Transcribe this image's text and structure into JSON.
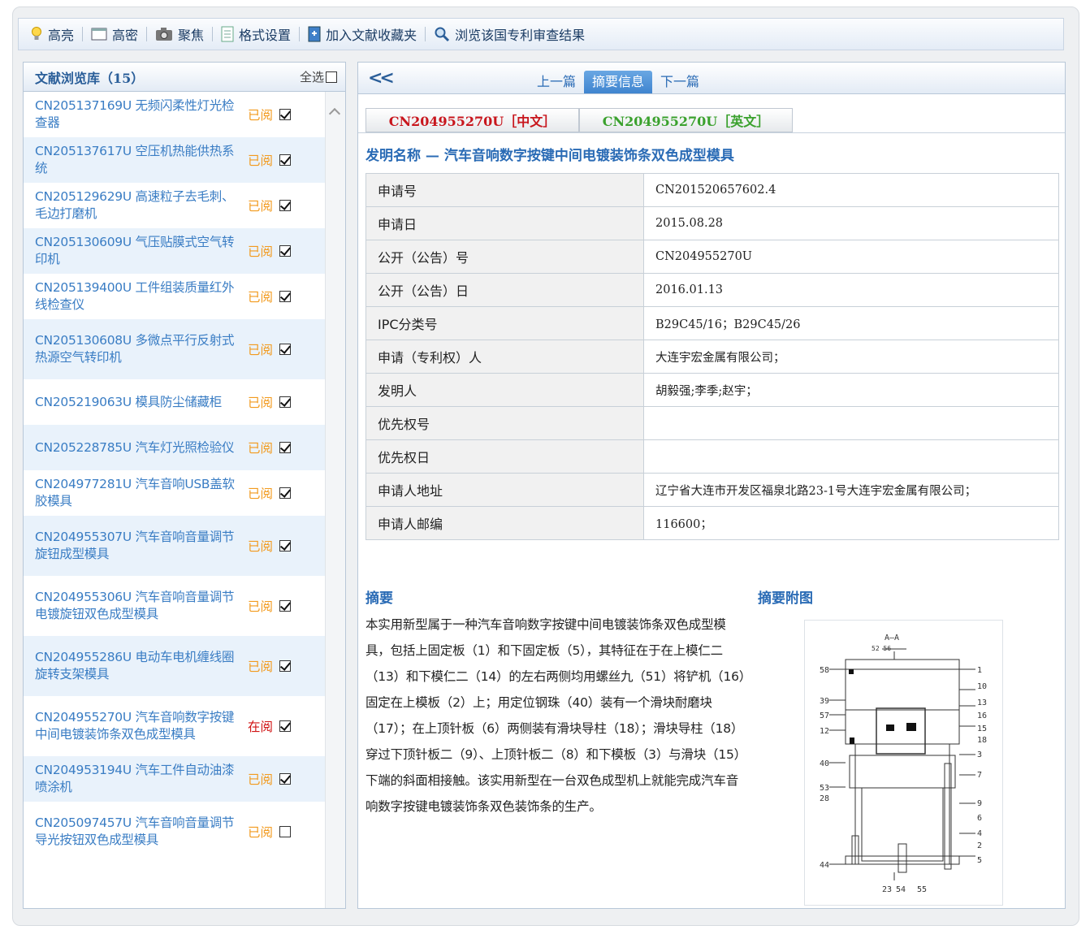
{
  "toolbar": {
    "items": [
      {
        "label": "高亮",
        "icon": "bulb-icon"
      },
      {
        "label": "高密",
        "icon": "window-icon"
      },
      {
        "label": "聚焦",
        "icon": "camera-icon"
      },
      {
        "label": "格式设置",
        "icon": "document-icon"
      },
      {
        "label": "加入文献收藏夹",
        "icon": "bookmark-add-icon"
      },
      {
        "label": "浏览该国专利审查结果",
        "icon": "magnifier-icon"
      }
    ]
  },
  "library": {
    "title": "文献浏览库（15）",
    "select_all": "全选",
    "items": [
      {
        "title": "CN205137169U 无频闪柔性灯光检查器",
        "status": "已阅",
        "checked": true
      },
      {
        "title": "CN205137617U 空压机热能供热系统",
        "status": "已阅",
        "checked": true
      },
      {
        "title": "CN205129629U 高速粒子去毛刺、毛边打磨机",
        "status": "已阅",
        "checked": true
      },
      {
        "title": "CN205130609U 气压贴膜式空气转印机",
        "status": "已阅",
        "checked": true
      },
      {
        "title": "CN205139400U 工件组装质量红外线检查仪",
        "status": "已阅",
        "checked": true
      },
      {
        "title": "CN205130608U 多微点平行反射式热源空气转印机",
        "status": "已阅",
        "checked": true
      },
      {
        "title": "CN205219063U 模具防尘储藏柜",
        "status": "已阅",
        "checked": true
      },
      {
        "title": "CN205228785U 汽车灯光照检验仪",
        "status": "已阅",
        "checked": true
      },
      {
        "title": "CN204977281U 汽车音响USB盖软胶模具",
        "status": "已阅",
        "checked": true
      },
      {
        "title": "CN204955307U 汽车音响音量调节旋钮成型模具",
        "status": "已阅",
        "checked": true
      },
      {
        "title": "CN204955306U 汽车音响音量调节电镀旋钮双色成型模具",
        "status": "已阅",
        "checked": true
      },
      {
        "title": "CN204955286U 电动车电机缠线圈旋转支架模具",
        "status": "已阅",
        "checked": true
      },
      {
        "title": "CN204955270U 汽车音响数字按键中间电镀装饰条双色成型模具",
        "status": "在阅",
        "checked": true,
        "current": true
      },
      {
        "title": "CN204953194U 汽车工件自动油漆喷涂机",
        "status": "已阅",
        "checked": true
      },
      {
        "title": "CN205097457U 汽车音响音量调节导光按钮双色成型模具",
        "status": "已阅",
        "checked": false
      }
    ]
  },
  "detail": {
    "back": "<<",
    "prev": "上一篇",
    "current_tab": "摘要信息",
    "next": "下一篇",
    "lang_cn": "CN204955270U［中文］",
    "lang_en": "CN204955270U［英文］",
    "invention_name": "发明名称 — 汽车音响数字按键中间电镀装饰条双色成型模具",
    "fields": [
      {
        "key": "申请号",
        "value": "CN201520657602.4"
      },
      {
        "key": "申请日",
        "value": "2015.08.28"
      },
      {
        "key": "公开（公告）号",
        "value": "CN204955270U"
      },
      {
        "key": "公开（公告）日",
        "value": "2016.01.13"
      },
      {
        "key": "IPC分类号",
        "value": "B29C45/16；B29C45/26"
      },
      {
        "key": "申请（专利权）人",
        "value": "大连宇宏金属有限公司；"
      },
      {
        "key": "发明人",
        "value": "胡毅强;李季;赵宇；"
      },
      {
        "key": "优先权号",
        "value": ""
      },
      {
        "key": "优先权日",
        "value": ""
      },
      {
        "key": "申请人地址",
        "value": "辽宁省大连市开发区福泉北路23-1号大连宇宏金属有限公司；"
      },
      {
        "key": "申请人邮编",
        "value": "116600；"
      }
    ],
    "abstract_heading": "摘要",
    "figure_heading": "摘要附图",
    "abstract": "本实用新型属于一种汽车音响数字按键中间电镀装饰条双色成型模具，包括上固定板（1）和下固定板（5），其特征在于在上模仁二（13）和下模仁二（14）的左右两侧均用螺丝九（51）将铲机（16）固定在上模板（2）上；用定位钢珠（40）装有一个滑块耐磨块（17）；在上顶针板（6）两侧装有滑块导柱（18）；滑块导柱（18）穿过下顶针板二（9）、上顶针板二（8）和下模板（3）与滑块（15）下端的斜面相接触。该实用新型在一台双色成型机上就能完成汽车音响数字按键电镀装饰条双色装饰条的生产。",
    "figure_labels": {
      "section": "A—A",
      "top": "52 56",
      "left": [
        "58",
        "39",
        "57",
        "12",
        "40",
        "53",
        "28",
        "44"
      ],
      "right": [
        "1",
        "10",
        "13",
        "16",
        "15",
        "18",
        "3",
        "7",
        "9",
        "6",
        "4",
        "2",
        "5"
      ],
      "bottom": [
        "23",
        "54",
        "55"
      ]
    }
  }
}
